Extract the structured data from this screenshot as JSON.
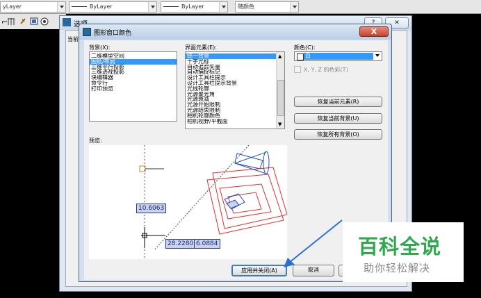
{
  "toolbar": {
    "layer_combo": "yLayer",
    "linetype_combo": "ByLayer",
    "lineweight_combo": "ByLayer",
    "color_combo": "随颜色"
  },
  "options_window": {
    "title": "选项",
    "side_label": "当前"
  },
  "dialog": {
    "title": "图形窗口颜色",
    "close_label": "X",
    "context_label": "背景(X):",
    "context_items": [
      "二维模型空间",
      "图纸/布局",
      "三维平行投影",
      "三维透视投影",
      "块编辑器",
      "命令行",
      "打印预览"
    ],
    "context_selected": 1,
    "interface_label": "界面元素(E):",
    "interface_items": [
      "统一背景",
      "十字光标",
      "自动追踪矢量",
      "自动捕捉标记",
      "设计工具栏提示",
      "设计工具栏提示背景",
      "光线轮廓",
      "光源聚光角",
      "光源衰减",
      "光源开始限制",
      "光源结束限制",
      "相机轮廓颜色",
      "相机视野/平截面"
    ],
    "interface_selected": 0,
    "color_label": "颜色(C):",
    "color_value": "白",
    "tint_label": "X, Y, Z 的色彩(T)",
    "restore_element_button": "恢复当前元素(R)",
    "restore_context_button": "恢复当前背景(U)",
    "restore_all_button": "恢复所有背景(O)",
    "preview_label": "预览:",
    "coord_tooltip_1": "10.6063",
    "coord_tooltip_2": "28.2280",
    "coord_tooltip_3": "6.0884",
    "apply_button": "应用并关闭(A)",
    "cancel_button": "取消"
  },
  "watermark": {
    "title": "百科全说",
    "subtitle": "助你轻松解决"
  },
  "colors": {
    "selection": "#3399ff",
    "preview_red": "#e03030",
    "preview_blue": "#2050c0",
    "watermark_green": "#2fa84f"
  }
}
